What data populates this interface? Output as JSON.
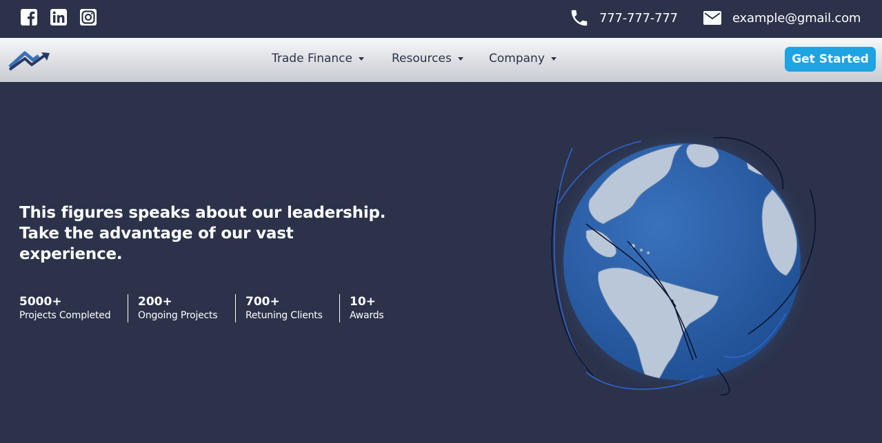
{
  "topbar": {
    "social": [
      "facebook-icon",
      "linkedin-icon",
      "instagram-icon"
    ],
    "phone": "777-777-777",
    "email": "example@gmail.com"
  },
  "nav": {
    "items": [
      {
        "label": "Trade Finance"
      },
      {
        "label": "Resources"
      },
      {
        "label": "Company"
      }
    ],
    "cta": "Get Started"
  },
  "hero": {
    "headline_lines": [
      "This figures speaks about our leadership.",
      "Take the advantage of our vast",
      "experience."
    ],
    "stats": [
      {
        "value": "5000+",
        "label": "Projects Completed"
      },
      {
        "value": "200+",
        "label": "Ongoing Projects"
      },
      {
        "value": "700+",
        "label": "Retuning Clients"
      },
      {
        "value": "10+",
        "label": "Awards"
      }
    ]
  },
  "colors": {
    "background": "#2b324a",
    "accent": "#1ea3e3",
    "nav_text": "#2c3348",
    "globe_ocean": "#2f63ab",
    "globe_land": "#b7c6d8"
  }
}
